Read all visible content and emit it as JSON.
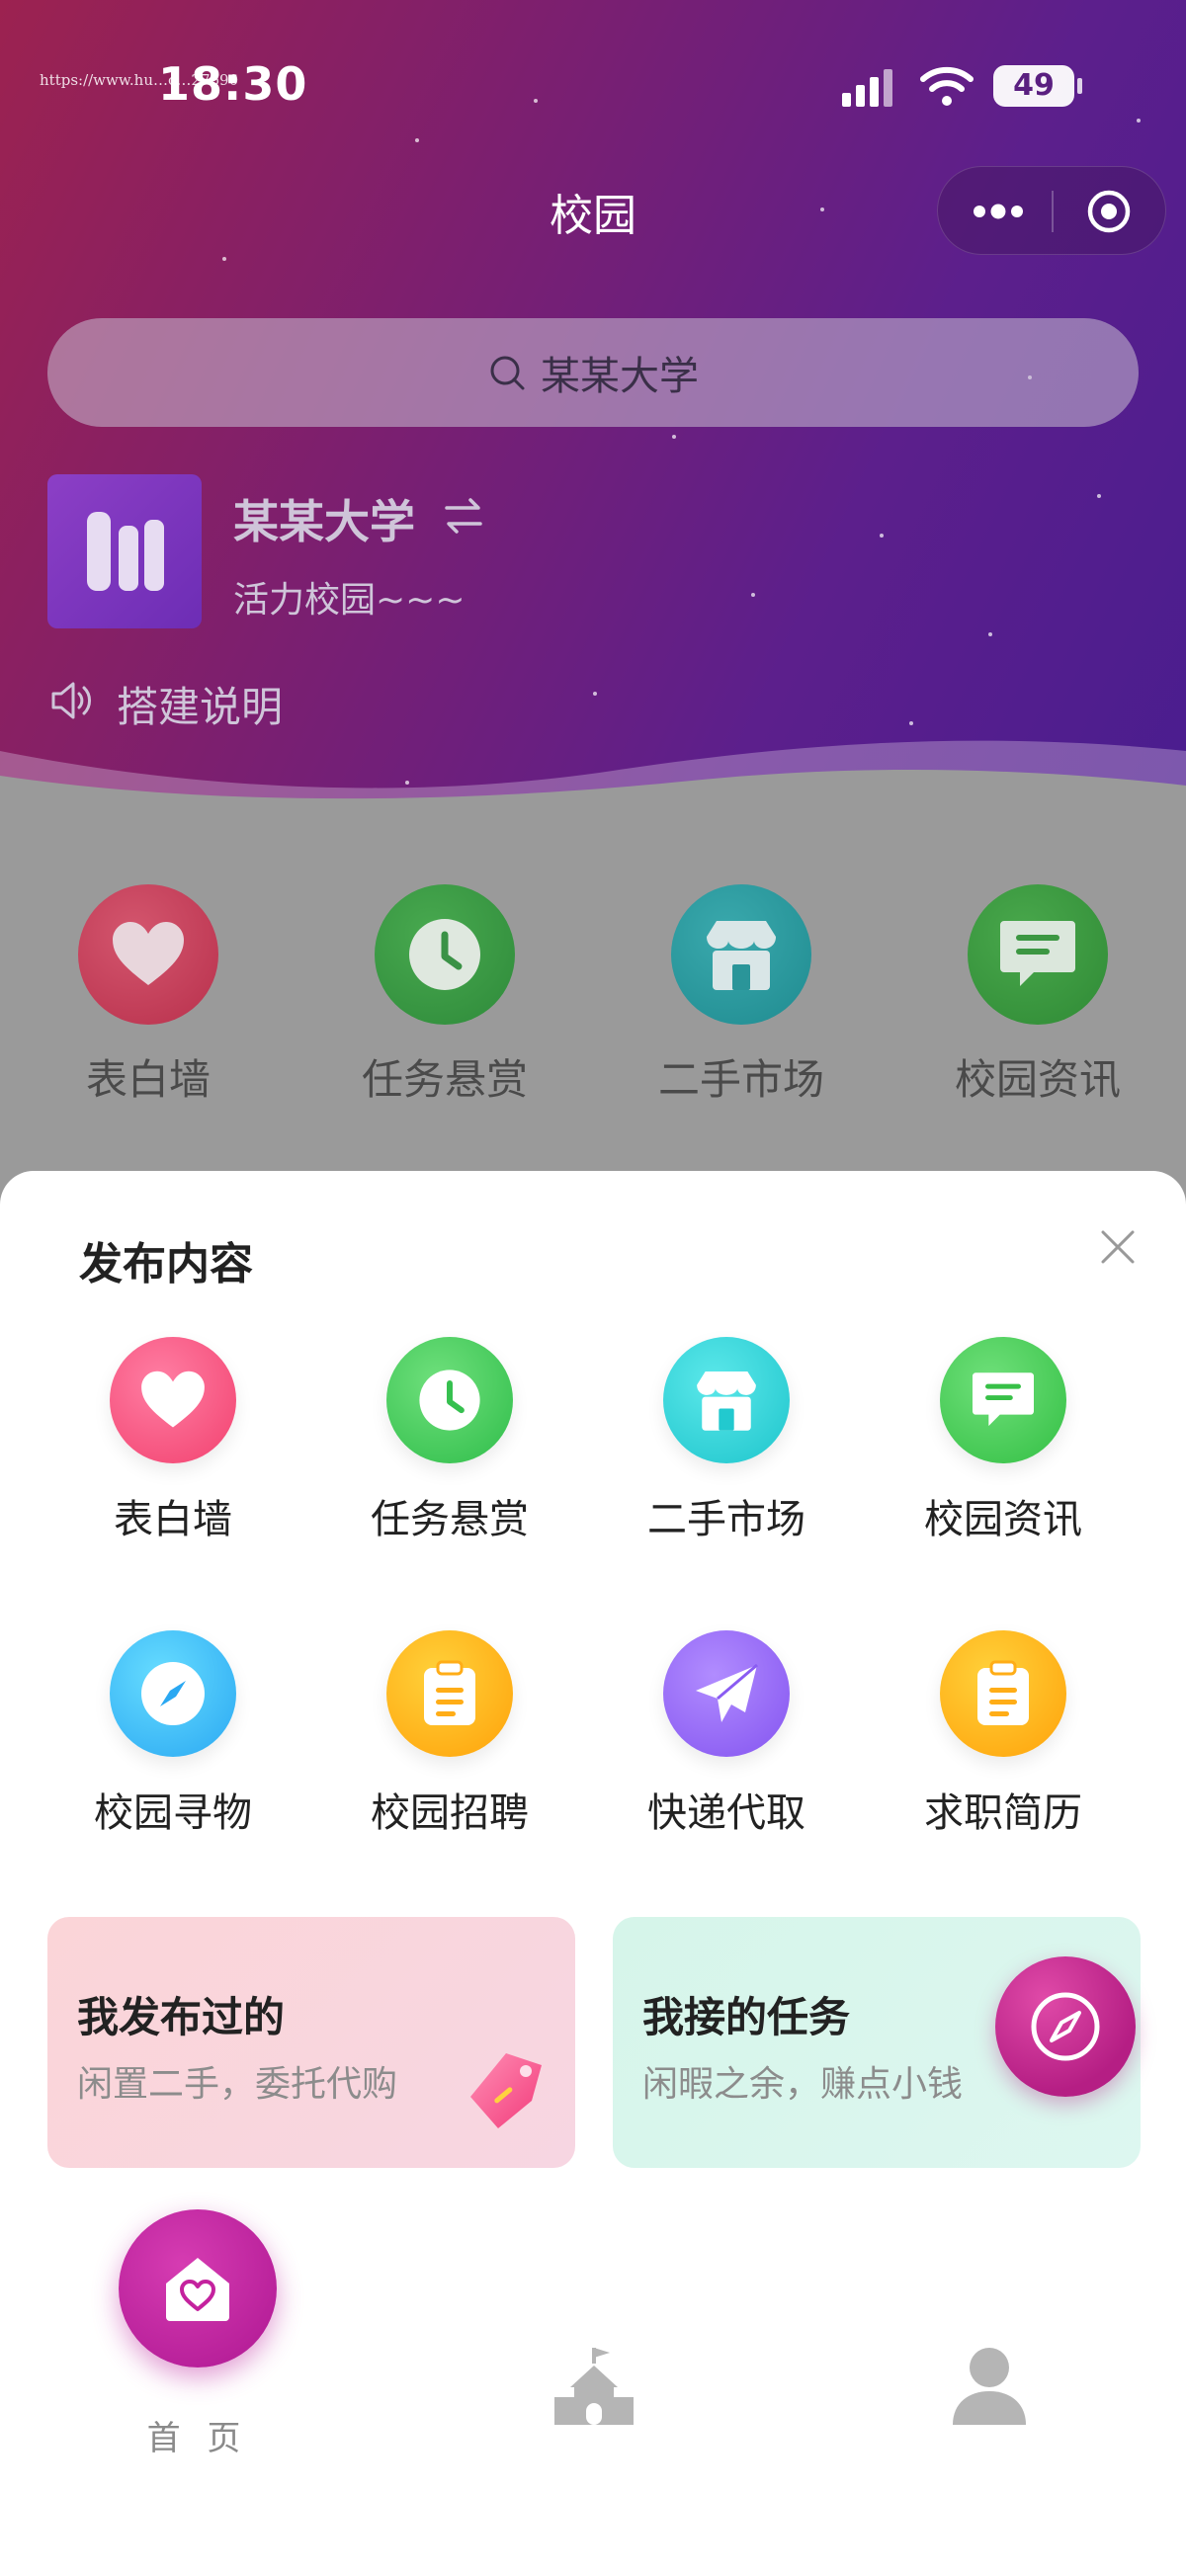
{
  "status_bar": {
    "time": "18:30",
    "url": "https://www.hu…c…27690",
    "battery": "49"
  },
  "header": {
    "title": "校园"
  },
  "search": {
    "placeholder": "某某大学"
  },
  "school": {
    "name": "某某大学",
    "slogan": "活力校园~~~",
    "announcement": "搭建说明"
  },
  "categories": [
    {
      "label": "表白墙",
      "icon": "heart-icon"
    },
    {
      "label": "任务悬赏",
      "icon": "clock-icon"
    },
    {
      "label": "二手市场",
      "icon": "shop-icon"
    },
    {
      "label": "校园资讯",
      "icon": "message-icon"
    }
  ],
  "sheet": {
    "title": "发布内容",
    "items": [
      {
        "label": "表白墙",
        "icon": "heart-icon"
      },
      {
        "label": "任务悬赏",
        "icon": "clock-icon"
      },
      {
        "label": "二手市场",
        "icon": "shop-icon"
      },
      {
        "label": "校园资讯",
        "icon": "message-icon"
      },
      {
        "label": "校园寻物",
        "icon": "compass-icon"
      },
      {
        "label": "校园招聘",
        "icon": "clipboard-icon"
      },
      {
        "label": "快递代取",
        "icon": "paper-plane-icon"
      },
      {
        "label": "求职简历",
        "icon": "clipboard-icon"
      }
    ],
    "cards": [
      {
        "title": "我发布过的",
        "subtitle": "闲置二手，委托代购"
      },
      {
        "title": "我接的任务",
        "subtitle": "闲暇之余，赚点小钱"
      }
    ]
  },
  "tabbar": {
    "home_label": "首 页"
  },
  "colors": {
    "accent": "#b8209a",
    "hero_start": "#9c2250",
    "hero_end": "#4a1d8f"
  }
}
